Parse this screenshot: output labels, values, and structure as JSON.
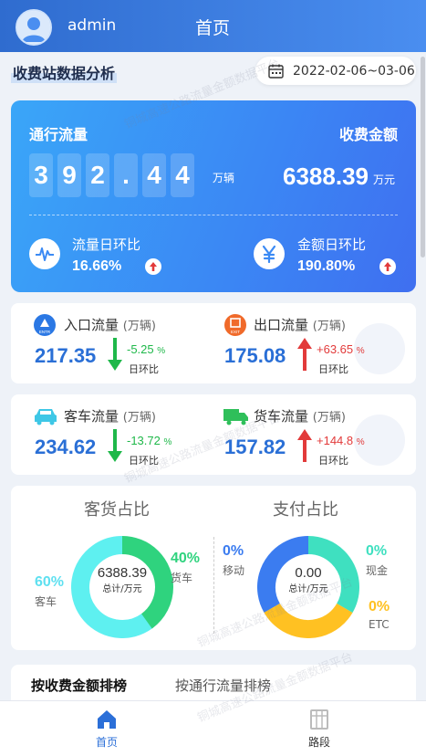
{
  "header": {
    "username": "admin",
    "title": "首页"
  },
  "section": {
    "title": "收费站数据分析",
    "date_range": "2022-02-06~03-06"
  },
  "summary": {
    "traffic_label": "通行流量",
    "traffic_digits": [
      "3",
      "9",
      "2",
      ".",
      "4",
      "4"
    ],
    "traffic_unit": "万辆",
    "amount_label": "收费金额",
    "amount_value": "6388.39",
    "amount_unit": "万元",
    "traffic_dod_label": "流量日环比",
    "traffic_dod_value": "16.66%",
    "amount_dod_label": "金额日环比",
    "amount_dod_value": "190.80%"
  },
  "entry_exit": {
    "entry": {
      "label": "入口流量",
      "unit": "(万辆)",
      "value": "217.35",
      "delta": "-5.25",
      "pct": "%",
      "dod": "日环比",
      "icon_text": "ENTR"
    },
    "exit": {
      "label": "出口流量",
      "unit": "(万辆)",
      "value": "175.08",
      "delta": "+63.65",
      "pct": "%",
      "dod": "日环比",
      "icon_text": "EXIT"
    }
  },
  "vehicle": {
    "passenger": {
      "label": "客车流量",
      "unit": "(万辆)",
      "value": "234.62",
      "delta": "-13.72",
      "pct": "%",
      "dod": "日环比"
    },
    "truck": {
      "label": "货车流量",
      "unit": "(万辆)",
      "value": "157.82",
      "delta": "+144.8",
      "pct": "%",
      "dod": "日环比"
    }
  },
  "ratios": {
    "cargo": {
      "title": "客货占比",
      "center_value": "6388.39",
      "center_sub": "总计/万元",
      "passenger_pct": "60%",
      "passenger_label": "客车",
      "passenger_fraction": 0.6,
      "truck_pct": "40%",
      "truck_label": "货车",
      "truck_fraction": 0.4
    },
    "payment": {
      "title": "支付占比",
      "center_value": "0.00",
      "center_sub": "总计/万元",
      "mobile_pct": "0%",
      "mobile_label": "移动",
      "cash_pct": "0%",
      "cash_label": "现金",
      "etc_pct": "0%",
      "etc_label": "ETC"
    }
  },
  "ranking": {
    "tab_amount": "按收费金额排榜",
    "tab_traffic": "按通行流量排榜"
  },
  "nav": {
    "home": "首页",
    "road": "路段"
  },
  "watermark": "铜城高速公路流量金额数据平台",
  "colors": {
    "primary": "#2f6ccf",
    "value_blue": "#2a6fd6",
    "down_green": "#1fb84a",
    "up_red": "#e23a3a",
    "passenger_cyan": "#5ef0f0",
    "truck_green": "#2fd37e",
    "mobile_blue": "#3b7cf0",
    "cash_teal": "#3fe0c0",
    "etc_yellow": "#ffc122"
  }
}
